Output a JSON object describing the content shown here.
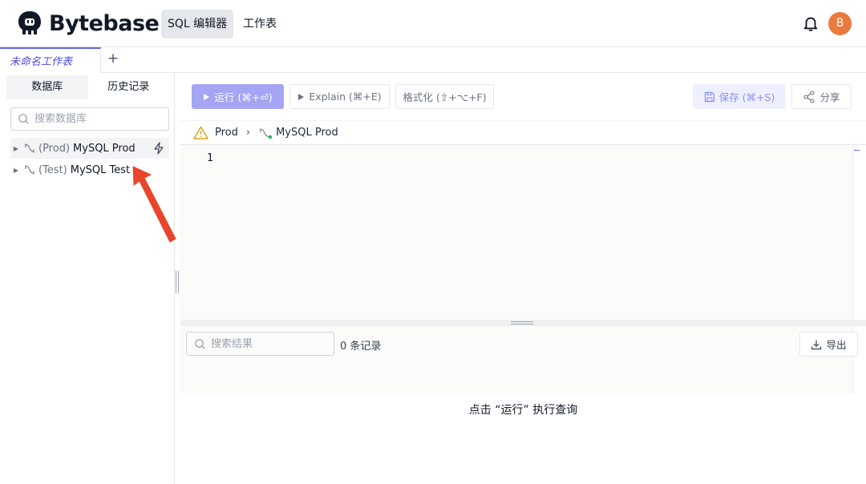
{
  "brand": {
    "name": "Bytebase",
    "accent": "#6366f1",
    "run_color": "#a5a5f3",
    "avatar_color": "#ea7a3d",
    "annotation_arrow_color": "#e8452c"
  },
  "nav": {
    "items": [
      {
        "label": "SQL 编辑器",
        "active": true
      },
      {
        "label": "工作表",
        "active": false
      }
    ]
  },
  "user": {
    "avatar_initial": "B"
  },
  "tabs": {
    "items": [
      {
        "label": "未命名工作表",
        "active": true
      }
    ],
    "add_label": "+"
  },
  "sidebar": {
    "tabs": [
      {
        "label": "数据库",
        "active": true
      },
      {
        "label": "历史记录",
        "active": false
      }
    ],
    "search_placeholder": "搜索数据库",
    "databases": [
      {
        "env": "(Prod)",
        "name": "MySQL Prod",
        "selected": true,
        "connected": true
      },
      {
        "env": "(Test)",
        "name": "MySQL Test",
        "selected": false,
        "connected": false
      }
    ]
  },
  "toolbar": {
    "run_label": "运行 (⌘+⏎)",
    "explain_label": "Explain (⌘+E)",
    "format_label": "格式化 (⇧+⌥+F)",
    "save_label": "保存 (⌘+S)",
    "share_label": "分享"
  },
  "connection": {
    "environment": "Prod",
    "instance": "MySQL Prod"
  },
  "editor": {
    "line_numbers": [
      "1"
    ]
  },
  "results": {
    "search_placeholder": "搜索结果",
    "count_label": "0 条记录",
    "export_label": "导出",
    "empty_message": "点击 “运行” 执行查询"
  }
}
